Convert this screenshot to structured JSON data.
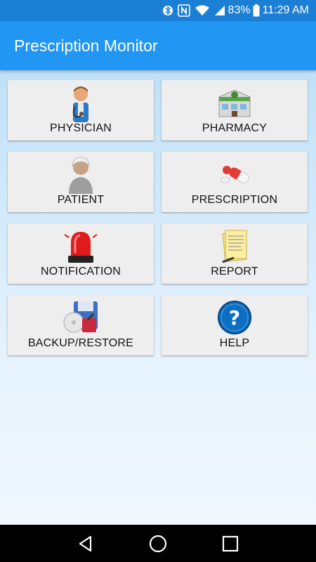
{
  "status_bar": {
    "battery": "83%",
    "time": "11:29 AM",
    "icons": [
      "bluetooth-icon",
      "nfc-icon",
      "wifi-icon",
      "signal-icon",
      "battery-icon"
    ]
  },
  "app_bar": {
    "title": "Prescription Monitor"
  },
  "menu": {
    "items": [
      {
        "label": "PHYSICIAN",
        "icon": "physician-icon"
      },
      {
        "label": "PHARMACY",
        "icon": "pharmacy-icon"
      },
      {
        "label": "PATIENT",
        "icon": "patient-icon"
      },
      {
        "label": "PRESCRIPTION",
        "icon": "pills-icon"
      },
      {
        "label": "NOTIFICATION",
        "icon": "siren-icon"
      },
      {
        "label": "REPORT",
        "icon": "report-icon"
      },
      {
        "label": "BACKUP/RESTORE",
        "icon": "backup-restore-icon"
      },
      {
        "label": "HELP",
        "icon": "help-icon"
      }
    ]
  },
  "nav_bar": {
    "buttons": [
      "back-icon",
      "home-icon",
      "recents-icon"
    ]
  },
  "colors": {
    "status_bar": "#1c7fd6",
    "app_bar": "#2196f3",
    "tile_bg": "#eeeeee",
    "nav_bar": "#000000"
  }
}
